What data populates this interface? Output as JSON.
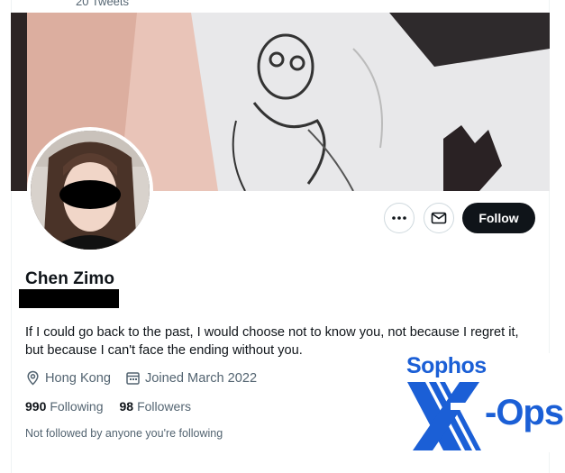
{
  "header": {
    "tweets_count": "20 Tweets"
  },
  "profile": {
    "name": "Chen Zimo",
    "bio": "If I could go back to the past, I would choose not to know you, not because I regret it, but because I can't face the ending without you.",
    "location": "Hong Kong",
    "joined": "Joined March 2022",
    "following_count": "990",
    "following_label": "Following",
    "followers_count": "98",
    "followers_label": "Followers",
    "not_followed_text": "Not followed by anyone you're following"
  },
  "actions": {
    "more_icon": "more-icon",
    "message_icon": "mail-icon",
    "follow_label": "Follow"
  },
  "watermark": {
    "brand": "Sophos",
    "product_x": "X",
    "product_ops": "-Ops",
    "color": "#1b5fd6"
  }
}
